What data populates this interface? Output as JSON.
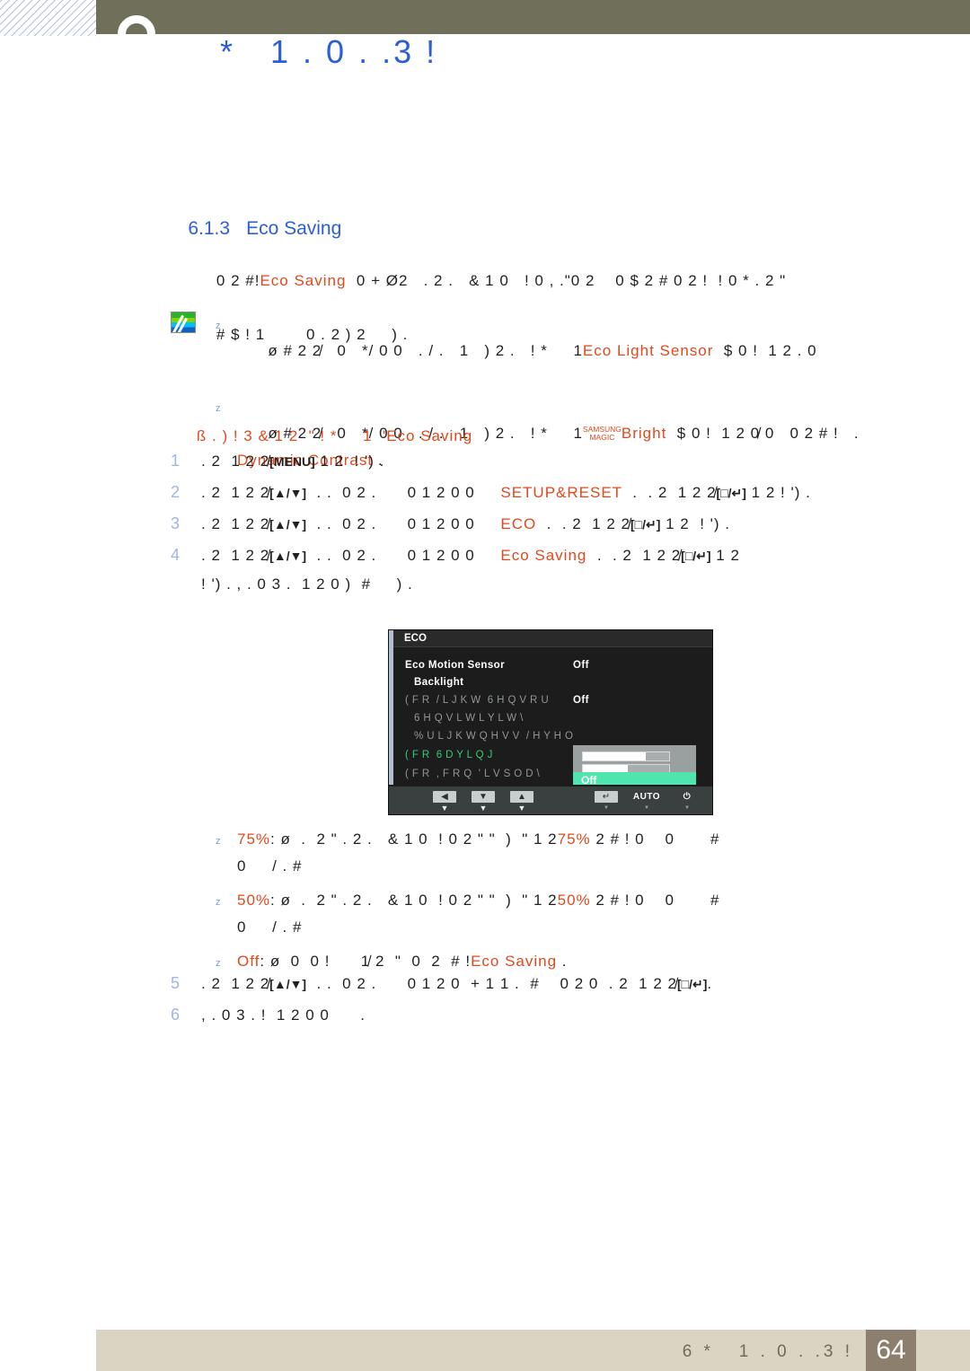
{
  "header": {
    "title": "*   1 . 0 . .3 !",
    "ring_icon": "circle-badge-icon"
  },
  "section": {
    "number": "6.1.3",
    "title": "Eco Saving"
  },
  "intro": {
    "line_1_a": "0 2 #!",
    "line_1_hl": "Eco Saving",
    "line_1_b": "  0 + Ø2   . 2 .   & 1 0   ! 0 , .\"0 2    0 $ 2 # 0 2 !  ! 0 * . 2 \"",
    "line_2": "# $ ! 1        0 . 2 ) 2     ) ."
  },
  "notes": [
    {
      "bullet": "z",
      "pre": "ø # 2 2̸   0   */ 0 0   . / .   1   ) 2 .   ! *     1",
      "hl": "Eco Light Sensor",
      "post": "  $ 0 !  1 2 . 0"
    },
    {
      "bullet": "z",
      "pre": "ø # 2 2̸   0   */ 0 0   . / .   1   ) 2 .   ! *     1",
      "magic_top": "SAMSUNG",
      "magic_bottom": "MAGIC",
      "hl": "Bright",
      "post": "  $ 0 !  1 2 0̸ 0   0 2 # !   .",
      "hl2": "Dynamic Contrast",
      "post2": " ."
    }
  ],
  "procedure_heading": {
    "prefix": "ß . ) ! 3 & 1 2  \" ! *     1  '",
    "term": "Eco Saving"
  },
  "steps": [
    {
      "num": "1",
      "parts": [
        {
          "t": "text",
          "v": ". 2  1 2 2̸"
        },
        {
          "t": "key",
          "v": "[MENU]"
        },
        {
          "t": "text",
          "v": " 1 2  ! ') ."
        }
      ]
    },
    {
      "num": "2",
      "parts": [
        {
          "t": "text",
          "v": ". 2  1 2 2̸"
        },
        {
          "t": "keyud",
          "v": "[▲/▼]"
        },
        {
          "t": "text",
          "v": "  . .  0 2 .      0 1 2 0 0     "
        },
        {
          "t": "hl",
          "v": "SETUP&RESET"
        },
        {
          "t": "text",
          "v": "  .  . 2  1 2 2̸"
        },
        {
          "t": "keyenter",
          "v": "[□/↵]"
        },
        {
          "t": "text",
          "v": " 1 2 ! ') ."
        }
      ]
    },
    {
      "num": "3",
      "parts": [
        {
          "t": "text",
          "v": ". 2  1 2 2̸"
        },
        {
          "t": "keyud",
          "v": "[▲/▼]"
        },
        {
          "t": "text",
          "v": "  . .  0 2 .      0 1 2 0 0     "
        },
        {
          "t": "hl",
          "v": "ECO"
        },
        {
          "t": "text",
          "v": "  .  . 2  1 2 2̸"
        },
        {
          "t": "keyenter",
          "v": "[□/↵]"
        },
        {
          "t": "text",
          "v": " 1 2  ! ') ."
        }
      ]
    },
    {
      "num": "4",
      "parts": [
        {
          "t": "text",
          "v": ". 2  1 2 2̸"
        },
        {
          "t": "keyud",
          "v": "[▲/▼]"
        },
        {
          "t": "text",
          "v": "  . .  0 2 .      0 1 2 0 0     "
        },
        {
          "t": "hl",
          "v": "Eco Saving"
        },
        {
          "t": "text",
          "v": "  .  . 2  1 2 2̸"
        },
        {
          "t": "keyenter",
          "v": "[□/↵]"
        },
        {
          "t": "text",
          "v": " 1 2\n! ') . , . 0 3 .  1 2 0 )  #     ) ."
        }
      ]
    }
  ],
  "steps_tail": [
    {
      "num": "5",
      "parts": [
        {
          "t": "text",
          "v": ". 2  1 2 2̸"
        },
        {
          "t": "keyud",
          "v": "[▲/▼]"
        },
        {
          "t": "text",
          "v": "  . .  0 2 .      0 1 2 0  + 1 1 .  #    0 2 0  . 2  1 2 2̸"
        },
        {
          "t": "keyenter",
          "v": "[□/↵]"
        },
        {
          "t": "text",
          "v": "."
        }
      ]
    },
    {
      "num": "6",
      "parts": [
        {
          "t": "text",
          "v": ", . 0 3 . !  1 2 0 0      ."
        }
      ]
    }
  ],
  "osd": {
    "title": "ECO",
    "rows": [
      {
        "label": "Eco Motion Sensor",
        "value": "Off",
        "state": "on",
        "indent": "label"
      },
      {
        "label": "Backlight",
        "value": "",
        "state": "on",
        "indent": "sub"
      },
      {
        "label": "( F R  / L J K W  6 H Q V R U",
        "value": "Off",
        "state": "dim",
        "indent": "label"
      },
      {
        "label": "6 H Q V L W L Y L W \\",
        "value": "",
        "state": "dim",
        "indent": "sub"
      },
      {
        "label": "% U L J K W Q H V V  / H Y H O",
        "value": "",
        "state": "dim",
        "indent": "sub"
      },
      {
        "label": "( F R  6 D Y L Q J",
        "value": "",
        "state": "sel",
        "indent": "label"
      },
      {
        "label": "( F R  , F R Q  ' L V S O D \\",
        "value": "",
        "state": "dim",
        "indent": "label"
      }
    ],
    "panel": {
      "selected_value": "Off"
    },
    "buttons": [
      {
        "glyph": "◀",
        "name": "left",
        "style": "key"
      },
      {
        "glyph": "▼",
        "name": "down",
        "style": "key"
      },
      {
        "glyph": "▲",
        "name": "up",
        "style": "key"
      },
      {
        "glyph": "↵",
        "name": "enter",
        "style": "key"
      },
      {
        "glyph": "AUTO",
        "name": "auto",
        "style": "plain"
      },
      {
        "glyph": "⏻",
        "name": "power",
        "style": "plain"
      }
    ]
  },
  "options": [
    {
      "bullet": "z",
      "hl": "75%",
      "a": ": ø  .  2 \" . 2 .   & 1 0  ! 0 2 \" \"  )  \" 1 2",
      "hl2": "75%",
      "b": " 2 # ! 0    0       #",
      "c": "0     / . #"
    },
    {
      "bullet": "z",
      "hl": "50%",
      "a": ": ø  .  2 \" . 2 .   & 1 0  ! 0 2 \" \"  )  \" 1 2",
      "hl2": "50%",
      "b": " 2 # ! 0    0       #",
      "c": "0     / . #"
    },
    {
      "bullet": "z",
      "hl": "Off",
      "a": ": ø  0  0 !      1̸ 2  \"  0  2  # !",
      "hl2": "Eco Saving",
      "b": " .",
      "c": ""
    }
  ],
  "footer": {
    "text": "6 *   1 . 0 . .3 !",
    "page": "64"
  }
}
